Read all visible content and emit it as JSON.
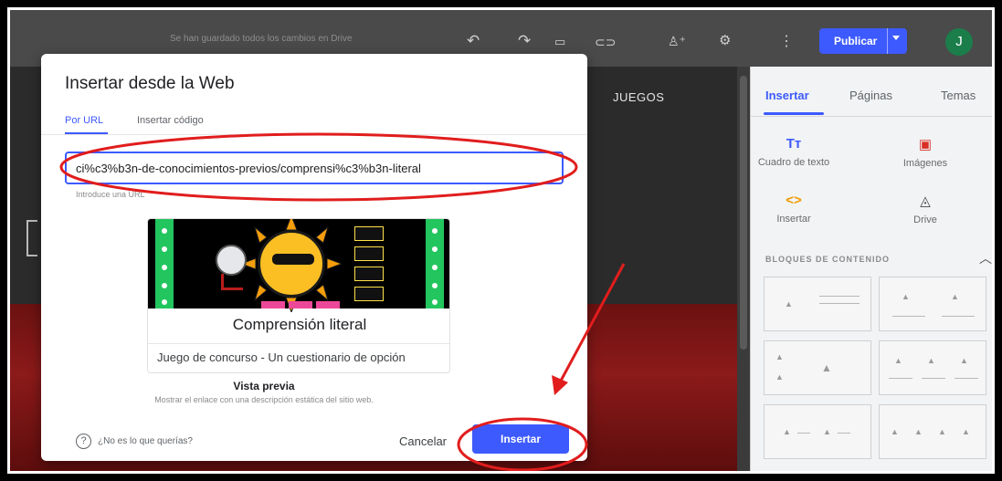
{
  "topbar": {
    "saved_status": "Se han guardado todos los cambios en Drive",
    "publish_label": "Publicar",
    "avatar_initial": "J",
    "icons": [
      "undo-icon",
      "redo-icon",
      "preview-icon",
      "link-icon",
      "add-person-icon",
      "settings-icon",
      "more-vert-icon"
    ]
  },
  "canvas": {
    "nav_label": "JUEGOS"
  },
  "right_panel": {
    "tabs": [
      {
        "label": "Insertar"
      },
      {
        "label": "Páginas"
      },
      {
        "label": "Temas"
      }
    ],
    "items": [
      {
        "label": "Cuadro de texto",
        "icon": "text-box-icon"
      },
      {
        "label": "Imágenes",
        "icon": "image-icon"
      },
      {
        "label": "Insertar",
        "icon": "embed-icon"
      },
      {
        "label": "Drive",
        "icon": "drive-icon"
      }
    ],
    "blocks_title": "BLOQUES DE CONTENIDO"
  },
  "dialog": {
    "title": "Insertar desde la Web",
    "tabs": [
      {
        "label": "Por URL"
      },
      {
        "label": "Insertar código"
      }
    ],
    "url_value": "ci%c3%b3n-de-conocimientos-previos/comprensi%c3%b3n-literal",
    "url_help": "Introduce una URL",
    "preview_card": {
      "title": "Comprensión literal",
      "description": "Juego de concurso - Un cuestionario de opción"
    },
    "preview_heading": "Vista previa",
    "preview_caption": "Mostrar el enlace con una descripción estática del sitio web.",
    "help_text": "¿No es lo que querías?",
    "cancel_label": "Cancelar",
    "insert_label": "Insertar"
  },
  "colors": {
    "accent": "#3d5afe",
    "annotation": "#e11d1d"
  }
}
